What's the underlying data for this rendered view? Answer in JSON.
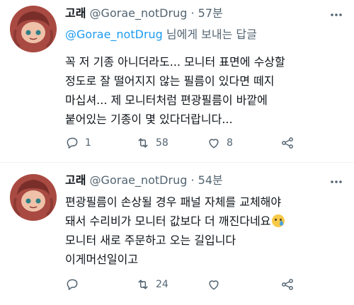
{
  "tweets": [
    {
      "name": "고래",
      "handle": "@Gorae_notDrug",
      "dot": "·",
      "time": "57분",
      "more_icon": "more-horizontal-icon",
      "replying_to_mention": "@Gorae_notDrug",
      "replying_to_suffix": " 님에게 보내는 답글",
      "text_lines": [
        "꼭 저 기종 아니더라도... 모니터 표면에 수상할",
        "정도로 잘 떨어지지 않는 필름이 있다면 떼지",
        "마십셔... 제 모니터처럼 편광필름이 바깥에",
        "붙어있는 기종이 몇 있다더랍니다..."
      ],
      "replies": "1",
      "retweets": "58",
      "likes": "8"
    },
    {
      "name": "고래",
      "handle": "@Gorae_notDrug",
      "dot": "·",
      "time": "54분",
      "more_icon": "more-horizontal-icon",
      "text_lines": [
        "편광필름이 손상될 경우 패널 자체를 교체해야",
        "돼서 수리비가 모니터 값보다 더 깨진다네요",
        "모니터 새로 주문하고 오는 길입니다",
        "이게머선일이고"
      ],
      "emoji": "crying-face-emoji",
      "replies": "",
      "retweets": "24",
      "likes": ""
    }
  ],
  "colors": {
    "text": "#0f1419",
    "secondary": "#536471",
    "link": "#1d9bf0",
    "divider": "#eff3f4"
  }
}
